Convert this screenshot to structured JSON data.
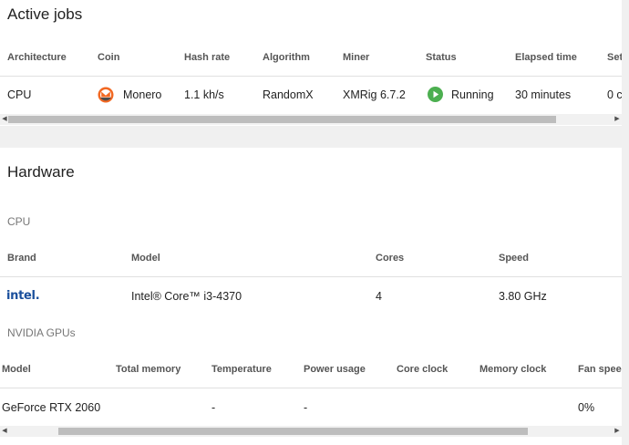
{
  "active_jobs": {
    "title": "Active jobs",
    "columns": [
      "Architecture",
      "Coin",
      "Hash rate",
      "Algorithm",
      "Miner",
      "Status",
      "Elapsed time",
      "Set"
    ],
    "row": {
      "architecture": "CPU",
      "coin": "Monero",
      "coin_icon": "monero-icon",
      "hash_rate": "1.1 kh/s",
      "algorithm": "RandomX",
      "miner": "XMRig 6.7.2",
      "status": "Running",
      "status_icon": "play-circle-icon",
      "elapsed_time": "30 minutes",
      "setting": "0 c"
    }
  },
  "hardware": {
    "title": "Hardware",
    "cpu": {
      "label": "CPU",
      "columns": [
        "Brand",
        "Model",
        "Cores",
        "Speed"
      ],
      "row": {
        "brand": "intel.",
        "model": "Intel® Core™ i3-4370",
        "cores": "4",
        "speed": "3.80 GHz"
      }
    },
    "gpu": {
      "label": "NVIDIA GPUs",
      "columns": [
        "Model",
        "Total memory",
        "Temperature",
        "Power usage",
        "Core clock",
        "Memory clock",
        "Fan speed"
      ],
      "row": {
        "model": "GeForce RTX 2060",
        "total_memory": "",
        "temperature": "-",
        "power_usage": "-",
        "core_clock": "",
        "memory_clock": "",
        "fan_speed": "0%"
      }
    }
  },
  "colors": {
    "monero_orange": "#f26822",
    "running_green": "#4caf50",
    "intel_blue": "#1a4f9c"
  }
}
